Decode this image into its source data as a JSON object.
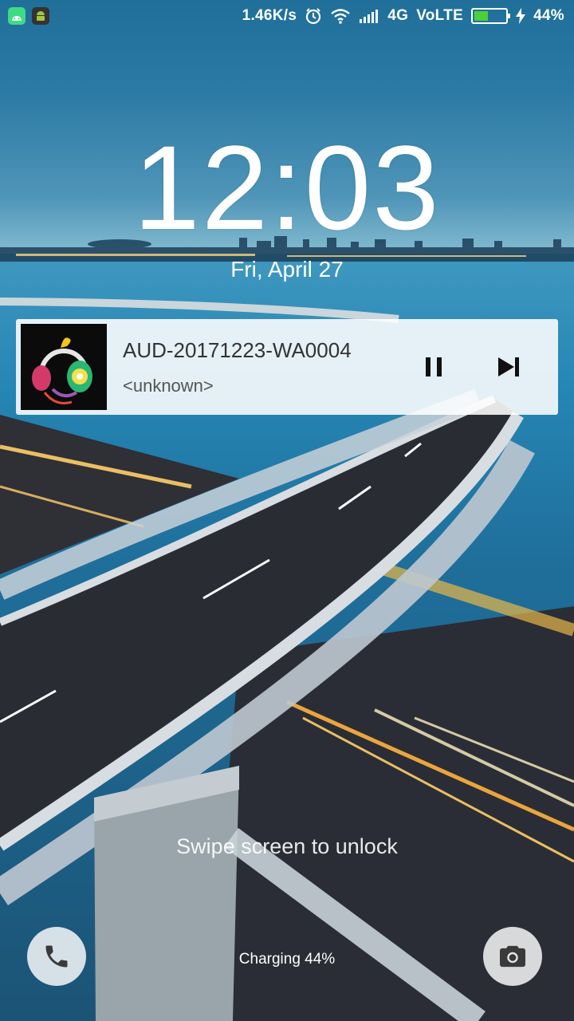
{
  "status_bar": {
    "network_speed": "1.46K/s",
    "network_type": "4G",
    "volte": "VoLTE",
    "battery_percent_text": "44%",
    "battery_level": 0.44,
    "icons": [
      "android-icon",
      "android-icon",
      "alarm-icon",
      "wifi-icon",
      "signal-icon",
      "battery-icon",
      "charging-bolt-icon"
    ]
  },
  "lockscreen": {
    "time": "12:03",
    "date": "Fri, April 27",
    "swipe_hint": "Swipe screen to unlock",
    "charging_text": "Charging 44%"
  },
  "media": {
    "title": "AUD-20171223-WA0004",
    "artist": "<unknown>",
    "controls": [
      "pause-icon",
      "skip-next-icon"
    ]
  },
  "shortcuts": {
    "left": "phone-icon",
    "right": "camera-icon"
  },
  "colors": {
    "battery_fill": "#4cd137",
    "card_bg": "#ffffffE0"
  }
}
